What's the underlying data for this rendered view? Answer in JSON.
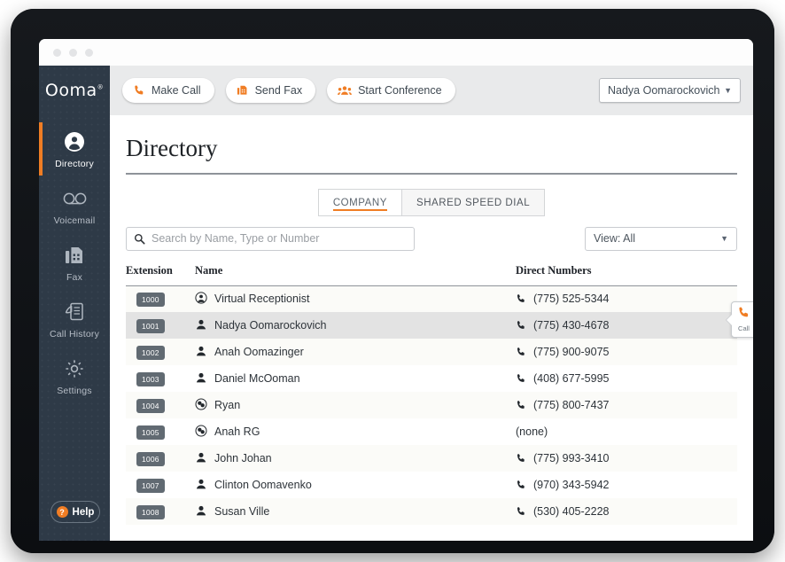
{
  "window": {
    "traffic_lights": [
      "dot-1",
      "dot-2",
      "dot-3"
    ]
  },
  "sidebar": {
    "logo": "Ooma",
    "logo_mark": "®",
    "items": [
      {
        "label": "Directory",
        "icon": "user-circle-icon",
        "active": true
      },
      {
        "label": "Voicemail",
        "icon": "voicemail-icon",
        "active": false
      },
      {
        "label": "Fax",
        "icon": "fax-icon",
        "active": false
      },
      {
        "label": "Call History",
        "icon": "call-history-icon",
        "active": false
      },
      {
        "label": "Settings",
        "icon": "gear-icon",
        "active": false
      }
    ],
    "help": {
      "label": "Help",
      "badge": "?"
    }
  },
  "toolbar": {
    "buttons": [
      {
        "label": "Make Call",
        "icon": "phone-icon"
      },
      {
        "label": "Send Fax",
        "icon": "fax-icon"
      },
      {
        "label": "Start Conference",
        "icon": "people-icon"
      }
    ],
    "user_select": {
      "value": "Nadya Oomarockovich",
      "caret": "▼"
    }
  },
  "page": {
    "title": "Directory",
    "tabs": [
      {
        "label": "COMPANY",
        "active": true
      },
      {
        "label": "SHARED SPEED DIAL",
        "active": false
      }
    ],
    "search": {
      "placeholder": "Search by Name, Type or Number",
      "value": "",
      "icon": "search-icon"
    },
    "view_select": {
      "value": "View: All",
      "caret": "▼"
    }
  },
  "table": {
    "columns": [
      "Extension",
      "Name",
      "Direct Numbers"
    ],
    "rows": [
      {
        "extension": "1000",
        "name": "Virtual Receptionist",
        "number": "(775) 525-5344",
        "icon": "virtual-receptionist-icon",
        "selected": false
      },
      {
        "extension": "1001",
        "name": "Nadya Oomarockovich",
        "number": "(775) 430-4678",
        "icon": "person-icon",
        "selected": true
      },
      {
        "extension": "1002",
        "name": "Anah Oomazinger",
        "number": "(775) 900-9075",
        "icon": "person-icon",
        "selected": false
      },
      {
        "extension": "1003",
        "name": "Daniel McOoman",
        "number": "(408) 677-5995",
        "icon": "person-icon",
        "selected": false
      },
      {
        "extension": "1004",
        "name": "Ryan",
        "number": "(775) 800-7437",
        "icon": "ring-group-icon",
        "selected": false
      },
      {
        "extension": "1005",
        "name": "Anah RG",
        "number": "(none)",
        "icon": "ring-group-icon",
        "selected": false
      },
      {
        "extension": "1006",
        "name": "John Johan",
        "number": "(775) 993-3410",
        "icon": "person-icon",
        "selected": false
      },
      {
        "extension": "1007",
        "name": "Clinton Oomavenko",
        "number": "(970) 343-5942",
        "icon": "person-icon",
        "selected": false
      },
      {
        "extension": "1008",
        "name": "Susan Ville",
        "number": "(530) 405-2228",
        "icon": "person-icon",
        "selected": false
      }
    ]
  },
  "call_callout": {
    "label": "Call",
    "icon": "phone-icon"
  },
  "colors": {
    "sidebar_bg": "#2e3a47",
    "accent_orange": "#f07d24",
    "toolbar_bg": "#e9eaeb",
    "badge_gray": "#616a72",
    "selected_row": "#e3e3e3"
  }
}
